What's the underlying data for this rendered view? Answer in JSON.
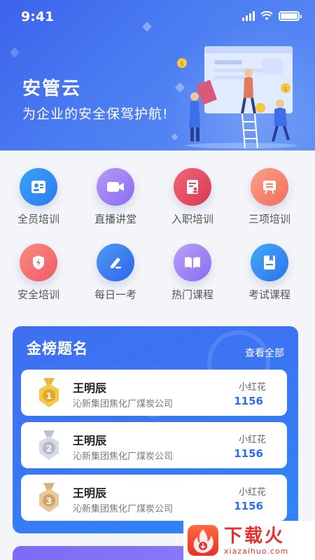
{
  "status_bar": {
    "time": "9:41"
  },
  "hero": {
    "title": "安管云",
    "slogan": "为企业的安全保驾护航!"
  },
  "grid": {
    "items": [
      {
        "label": "全员培训",
        "icon": "id-card-icon",
        "color": "#2f8ff3"
      },
      {
        "label": "直播讲堂",
        "icon": "video-camera-icon",
        "color": "#9c7cf5"
      },
      {
        "label": "入职培训",
        "icon": "document-person-icon",
        "color": "#e8475c"
      },
      {
        "label": "三项培训",
        "icon": "easel-board-icon",
        "color": "#f5856a"
      },
      {
        "label": "安全培训",
        "icon": "shield-lightning-icon",
        "color": "#f36f6f"
      },
      {
        "label": "每日一考",
        "icon": "pencil-icon",
        "color": "#3f7ef2"
      },
      {
        "label": "热门课程",
        "icon": "open-book-icon",
        "color": "#9c7cf5"
      },
      {
        "label": "考试课程",
        "icon": "bookmark-book-icon",
        "color": "#3a8cf4"
      }
    ]
  },
  "ranking": {
    "title": "金榜题名",
    "more": "查看全部",
    "entries": [
      {
        "rank": "1",
        "medal": "gold-medal-icon",
        "name": "王明辰",
        "company": "沁新集团焦化厂煤炭公司",
        "flower_label": "小红花",
        "score": "1156"
      },
      {
        "rank": "2",
        "medal": "silver-medal-icon",
        "name": "王明辰",
        "company": "沁新集团焦化厂煤炭公司",
        "flower_label": "小红花",
        "score": "1156"
      },
      {
        "rank": "3",
        "medal": "bronze-medal-icon",
        "name": "王明辰",
        "company": "沁新集团焦化厂煤炭公司",
        "flower_label": "小红花",
        "score": "1156"
      }
    ]
  },
  "watermark": {
    "big": "下载火",
    "small": "xiazaihuo.com"
  }
}
